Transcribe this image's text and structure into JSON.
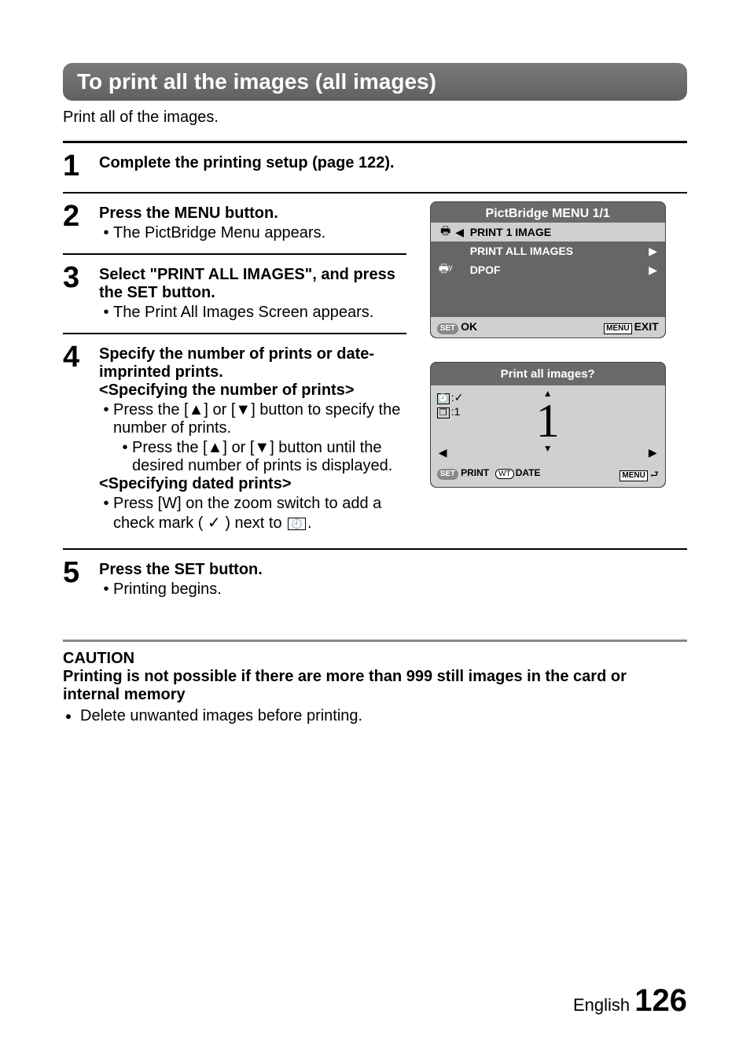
{
  "section_header": "To print all the images (all images)",
  "intro": "Print all of the images.",
  "steps": {
    "s1": {
      "num": "1",
      "title": "Complete the printing setup (page 122)."
    },
    "s2": {
      "num": "2",
      "title": "Press the MENU button.",
      "b1": "The PictBridge Menu appears."
    },
    "s3": {
      "num": "3",
      "title": "Select \"PRINT ALL IMAGES\", and press the SET button.",
      "b1": "The Print All Images Screen appears."
    },
    "s4": {
      "num": "4",
      "title": "Specify the number of prints or date-imprinted prints.",
      "sub_a": "<Specifying the number of prints>",
      "b1": "Press the [▲] or [▼] button to specify the number of prints.",
      "b1a": "Press the [▲] or [▼] button until the desired number of prints is displayed.",
      "sub_b": "<Specifying dated prints>",
      "b2a": "Press [W] on the zoom switch to add a check mark ( ✓ ) next to",
      "b2b": "."
    },
    "s5": {
      "num": "5",
      "title": "Press the SET button.",
      "b1": "Printing begins."
    }
  },
  "fig1": {
    "title": "PictBridge MENU 1/1",
    "row1": "PRINT 1 IMAGE",
    "row2": "PRINT ALL IMAGES",
    "row3": "DPOF",
    "ok_badge": "SET",
    "ok": "OK",
    "menu_badge": "MENU",
    "exit": "EXIT"
  },
  "fig2": {
    "title": "Print all images?",
    "clock_val": ":✓",
    "copies_val": ":1",
    "center": "1",
    "set_badge": "SET",
    "print": "PRINT",
    "wt_badge": "WT",
    "date": "DATE",
    "menu_badge": "MENU"
  },
  "caution": {
    "title": "CAUTION",
    "sub": "Printing is not possible if there are more than 999 still images in the card or internal memory",
    "item": "Delete unwanted images before printing."
  },
  "footer": {
    "lang": "English",
    "page": "126"
  }
}
